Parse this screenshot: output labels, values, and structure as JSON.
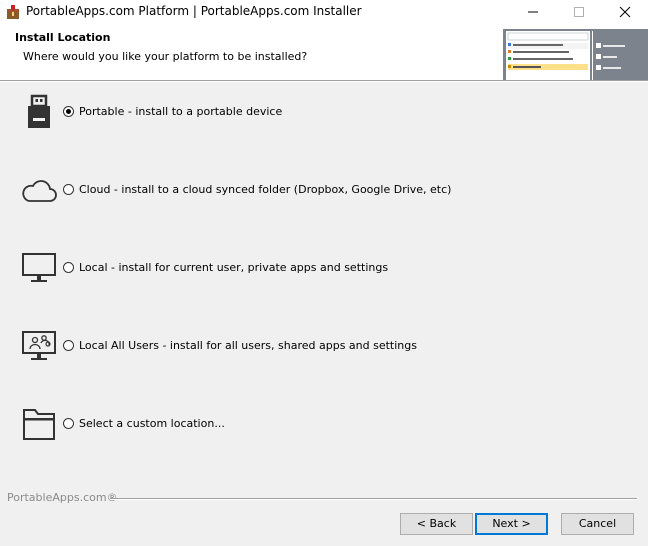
{
  "window": {
    "title": "PortableApps.com Platform | PortableApps.com Installer",
    "icon": "portableapps-installer-icon"
  },
  "header": {
    "title": "Install Location",
    "subtitle": "Where would you like your platform to be installed?"
  },
  "options": [
    {
      "icon": "usb-drive-icon",
      "label": "Portable - install to a portable device",
      "selected": true
    },
    {
      "icon": "cloud-icon",
      "label": "Cloud - install to a cloud synced folder (Dropbox, Google Drive, etc)",
      "selected": false
    },
    {
      "icon": "monitor-icon",
      "label": "Local - install for current user, private apps and settings",
      "selected": false
    },
    {
      "icon": "monitor-users-icon",
      "label": "Local All Users - install for all users, shared apps and settings",
      "selected": false
    },
    {
      "icon": "folder-icon",
      "label": "Select a custom location...",
      "selected": false
    }
  ],
  "branding": "PortableApps.com®",
  "buttons": {
    "back": "< Back",
    "next": "Next >",
    "cancel": "Cancel"
  },
  "colors": {
    "window_bg": "#f0f0f0",
    "header_bg": "#ffffff",
    "focus_border": "#0078d7"
  }
}
